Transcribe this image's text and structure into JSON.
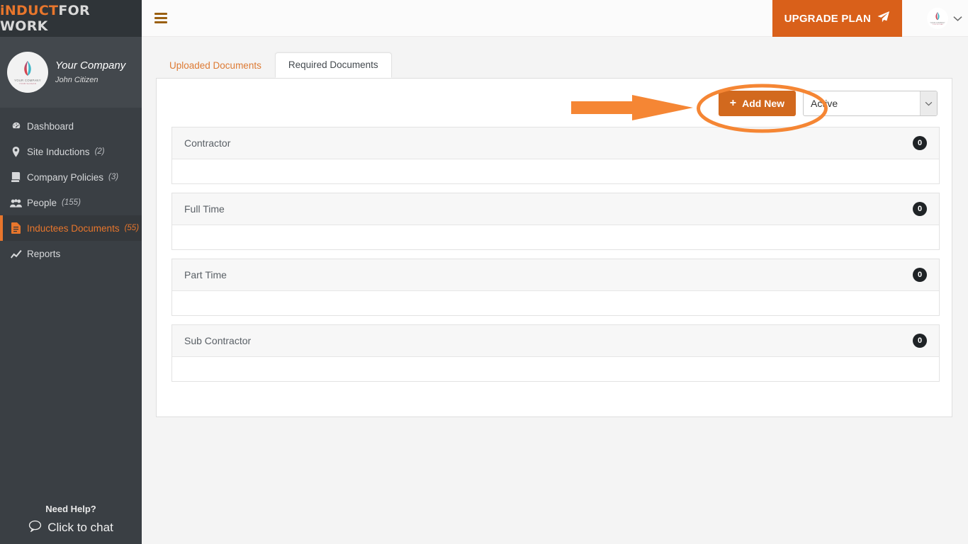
{
  "brand": {
    "part1": "iNDUCT",
    "part2": "FOR WORK"
  },
  "company": {
    "name": "Your Company",
    "user": "John Citizen",
    "logo_label": "YOUR COMPANY",
    "logo_sub": "YOUR SLOGAN"
  },
  "sidebar": {
    "items": [
      {
        "label": "Dashboard",
        "icon": "dashboard-icon",
        "count": "",
        "active": false
      },
      {
        "label": "Site Inductions",
        "icon": "map-pin-icon",
        "count": "(2)",
        "active": false
      },
      {
        "label": "Company Policies",
        "icon": "book-icon",
        "count": "(3)",
        "active": false
      },
      {
        "label": "People",
        "icon": "people-icon",
        "count": "(155)",
        "active": false
      },
      {
        "label": "Inductees Documents",
        "icon": "document-icon",
        "count": "(55)",
        "active": true
      },
      {
        "label": "Reports",
        "icon": "chart-icon",
        "count": "",
        "active": false
      }
    ],
    "help": {
      "title": "Need Help?",
      "chat_label": "Click to chat",
      "chat_icon": "chat-bubble-icon"
    }
  },
  "topbar": {
    "menu_icon": "hamburger-icon",
    "upgrade_label": "UPGRADE PLAN",
    "upgrade_icon": "paper-plane-icon",
    "caret_icon": "chevron-down-icon"
  },
  "main": {
    "tabs": [
      {
        "label": "Uploaded Documents",
        "active": false
      },
      {
        "label": "Required Documents",
        "active": true
      }
    ],
    "toolbar": {
      "add_new_label": "Add New",
      "add_new_icon": "plus-icon",
      "status_value": "Active",
      "status_arrow_icon": "chevron-down-icon"
    },
    "panels": [
      {
        "title": "Contractor",
        "count": "0"
      },
      {
        "title": "Full Time",
        "count": "0"
      },
      {
        "title": "Part Time",
        "count": "0"
      },
      {
        "title": "Sub Contractor",
        "count": "0"
      }
    ]
  },
  "annotations": {
    "arrow": "orange-arrow-pointing-right",
    "ellipse": "orange-ellipse-highlight",
    "color": "#f58634"
  },
  "colors": {
    "accent": "#e8762c",
    "sidebar_bg": "#3a3f44",
    "upgrade_bg": "#d9601a",
    "add_new_bg": "#d2691e",
    "badge_bg": "#1f2326",
    "annotation": "#f58634"
  }
}
